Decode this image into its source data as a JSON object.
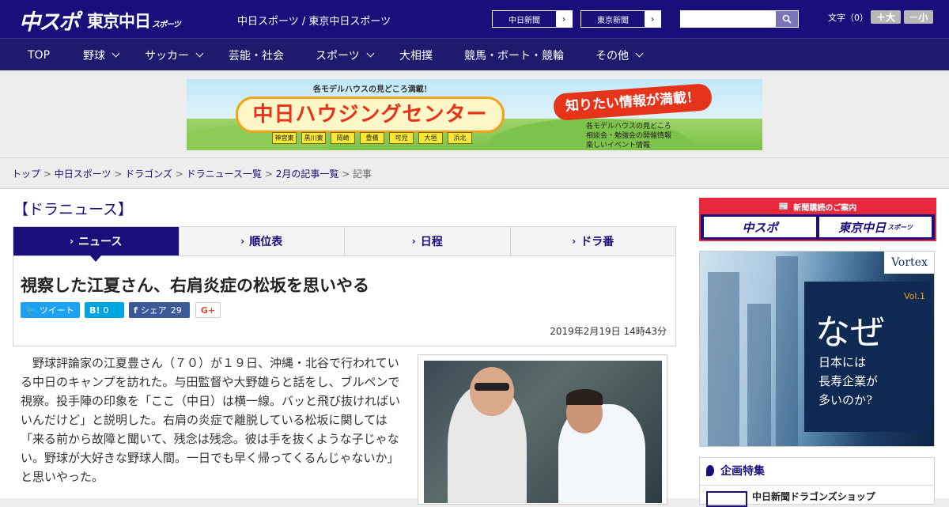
{
  "header": {
    "logo_primary": "中スポ",
    "logo_secondary": "東京中日",
    "logo_secondary_small": "スポーツ",
    "tagline": "中日スポーツ / 東京中日スポーツ",
    "btn_chunichi": "中日新聞",
    "btn_tokyo": "東京新聞",
    "search_placeholder": "",
    "font_size_label": "文字（0）",
    "font_plus": "＋大",
    "font_minus": "－小"
  },
  "nav": {
    "items": [
      {
        "label": "TOP",
        "has_dropdown": false
      },
      {
        "label": "野球",
        "has_dropdown": true
      },
      {
        "label": "サッカー",
        "has_dropdown": true
      },
      {
        "label": "芸能・社会",
        "has_dropdown": false
      },
      {
        "label": "スポーツ",
        "has_dropdown": true
      },
      {
        "label": "大相撲",
        "has_dropdown": false
      },
      {
        "label": "競馬・ボート・競輪",
        "has_dropdown": false
      },
      {
        "label": "その他",
        "has_dropdown": true
      }
    ]
  },
  "banner": {
    "top_text": "各モデルハウスの見どころ満載！",
    "main": "中日ハウジングセンター",
    "right": "知りたい情報が満載！",
    "list": [
      "各モデルハウスの見どころ",
      "相談会・勉強会の開催情報",
      "楽しいイベント情報"
    ],
    "towns": [
      "神宮東",
      "黒川東",
      "岡崎",
      "豊橋",
      "可児",
      "大垣",
      "浜北"
    ]
  },
  "breadcrumb": {
    "items": [
      "トップ",
      "中日スポーツ",
      "ドラゴンズ",
      "ドラニュース一覧",
      "2月の記事一覧"
    ],
    "current": "記事",
    "sep": " > "
  },
  "section_title": "【ドラニュース】",
  "tabs": [
    "ニュース",
    "順位表",
    "日程",
    "ドラ番"
  ],
  "article": {
    "headline": "視察した江夏さん、右肩炎症の松坂を思いやる",
    "date": "2019年2月19日 14時43分",
    "share": {
      "tweet": "ツイート",
      "hatena_count": "0",
      "facebook": "シェア",
      "facebook_count": "29",
      "gplus": "G+"
    },
    "body": "　野球評論家の江夏豊さん（７０）が１９日、沖縄・北谷で行われている中日のキャンプを訪れた。与田監督や大野雄らと話をし、ブルペンで視察。投手陣の印象を「ここ（中日）は横一線。バッと飛び抜ければいいんだけど」と説明した。右肩の炎症で離脱している松坂に関しては「来る前から故障と聞いて、残念は残念。彼は手を抜くような子じゃない。野球が大好きな野球人間。一日でも早く帰ってくるんじゃないか」と思いやった。"
  },
  "sidebar": {
    "subscribe_title": "新聞購読のご案内",
    "subscribe_btn1": "中スポ",
    "subscribe_btn2": "東京中日",
    "subscribe_btn2_small": "スポーツ",
    "ad": {
      "brand": "Vortex",
      "vol": "Vol.1",
      "headline": "なぜ",
      "sub_lines": [
        "日本には",
        "長寿企業が",
        "多いのか?"
      ]
    },
    "feature_title": "企画特集",
    "feature_item": "中日新聞ドラゴンズショップ"
  }
}
